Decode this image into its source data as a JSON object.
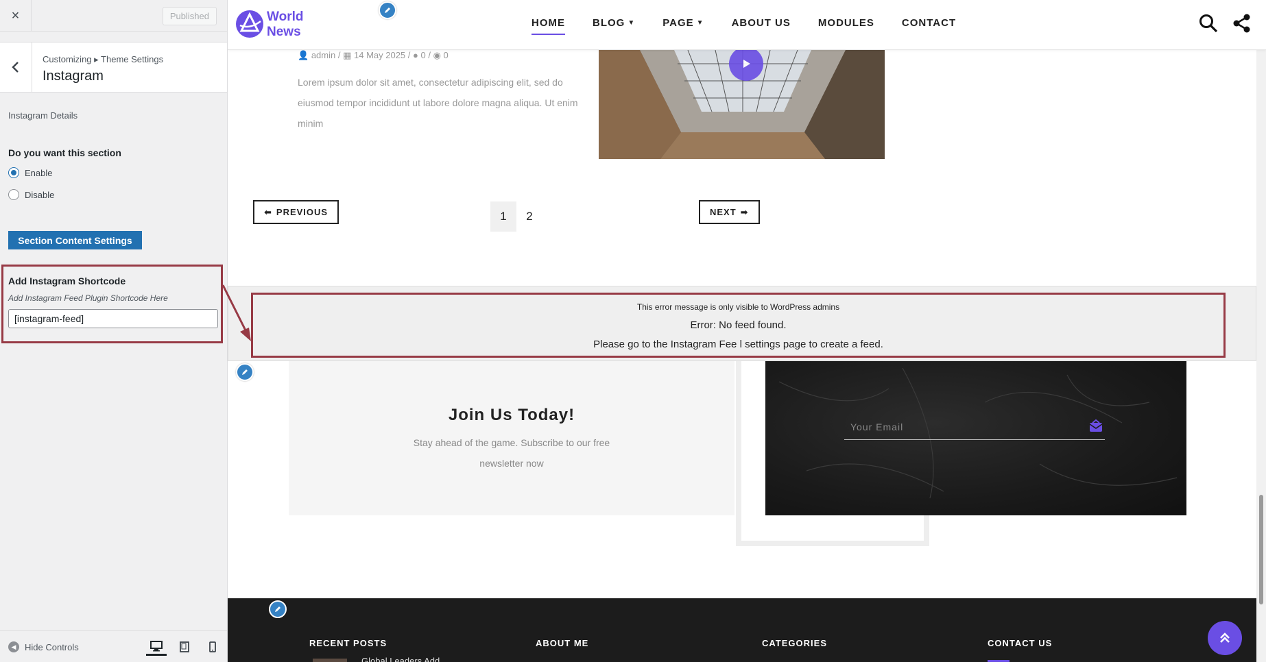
{
  "customizer": {
    "close_icon": "×",
    "published_label": "Published",
    "breadcrumb": "Customizing ▸ Theme Settings",
    "panel_title": "Instagram",
    "section_label": "Instagram Details",
    "question": "Do you want this section",
    "radio_options": [
      {
        "label": "Enable",
        "checked": true
      },
      {
        "label": "Disable",
        "checked": false
      }
    ],
    "section_button": "Section Content Settings",
    "shortcode_title": "Add Instagram Shortcode",
    "shortcode_desc": "Add Instagram Feed Plugin Shortcode Here",
    "shortcode_value": "[instagram-feed]",
    "hide_controls": "Hide Controls",
    "devices": [
      "desktop-icon",
      "tablet-icon",
      "mobile-icon"
    ]
  },
  "site": {
    "logo_line1": "World",
    "logo_line2": "News",
    "brand_color": "#6a4ee4",
    "menu": [
      {
        "label": "HOME",
        "active": true,
        "dropdown": false
      },
      {
        "label": "BLOG",
        "active": false,
        "dropdown": true
      },
      {
        "label": "PAGE",
        "active": false,
        "dropdown": true
      },
      {
        "label": "ABOUT US",
        "active": false,
        "dropdown": false
      },
      {
        "label": "MODULES",
        "active": false,
        "dropdown": false
      },
      {
        "label": "CONTACT",
        "active": false,
        "dropdown": false
      }
    ],
    "post": {
      "author": "admin",
      "date": "14 May 2025",
      "comments": "0",
      "views": "0",
      "excerpt": "Lorem ipsum dolor sit amet, consectetur adipiscing elit, sed do eiusmod tempor incididunt ut labore dolore magna aliqua. Ut enim minim"
    },
    "pagination": {
      "prev": "PREVIOUS",
      "next": "NEXT",
      "pages": [
        "1",
        "2"
      ],
      "current": "1"
    },
    "error": {
      "line1": "This error message is only visible to WordPress admins",
      "line2": "Error: No feed found.",
      "line3": "Please go to the Instagram Fee  l settings page to create a feed."
    },
    "newsletter": {
      "title": "Join Us Today!",
      "desc": "Stay ahead of the game. Subscribe to our free newsletter now",
      "email_placeholder": "Your Email"
    },
    "footer": {
      "columns": [
        "RECENT POSTS",
        "ABOUT ME",
        "CATEGORIES",
        "CONTACT US"
      ],
      "recent_post_text": "Global Leaders Add"
    },
    "annotation_color": "#973a45"
  }
}
